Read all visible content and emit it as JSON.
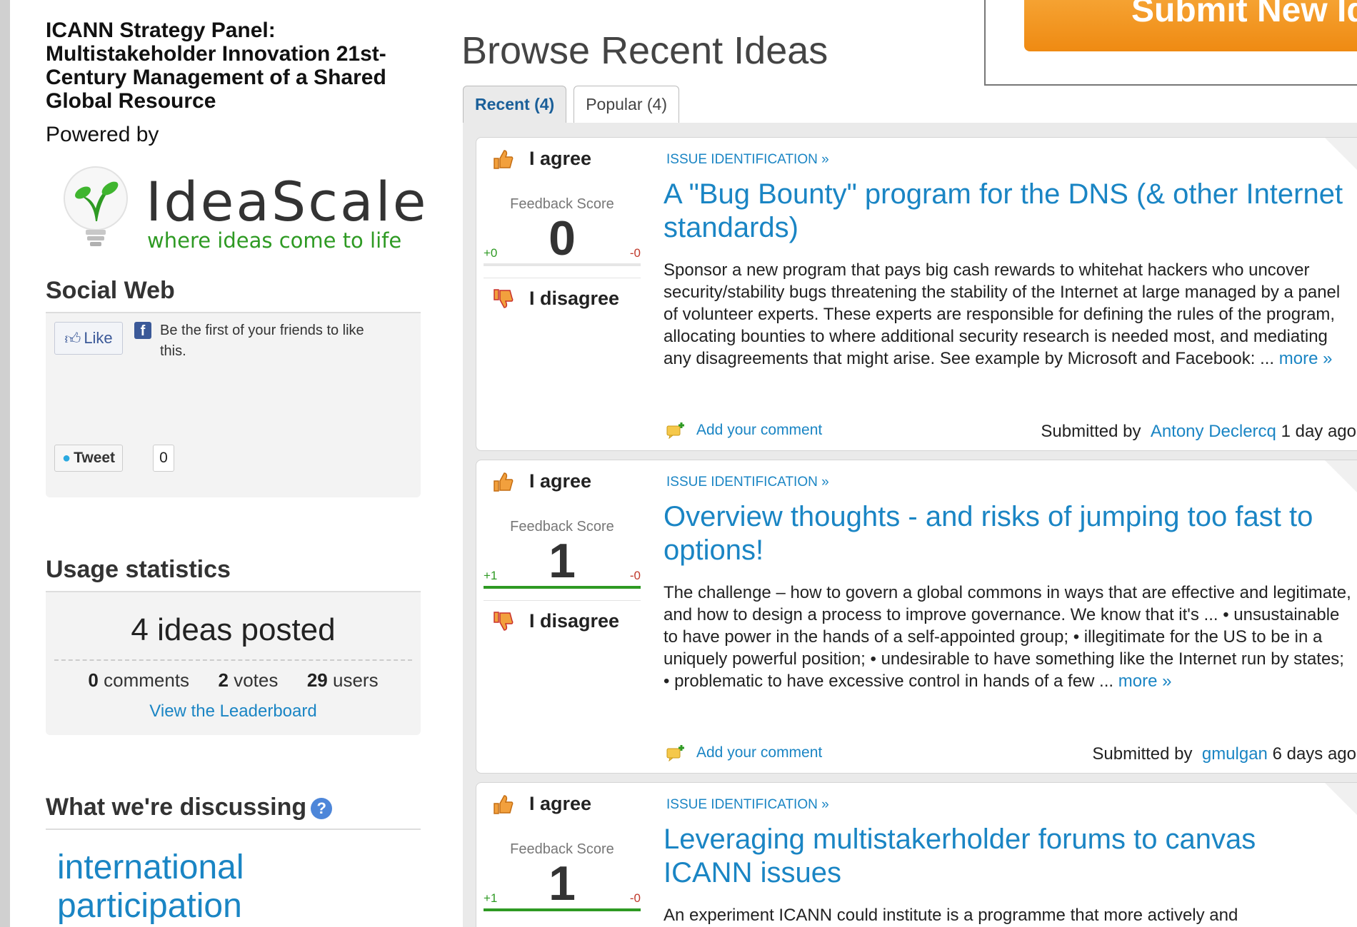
{
  "sidebar": {
    "site_title": "ICANN Strategy Panel: Multistakeholder Innovation 21st-Century Management of a Shared Global Resource",
    "powered_by": "Powered by",
    "logo_word": "IdeaScale",
    "logo_tagline": "where ideas come to life",
    "social_heading": "Social Web",
    "like_label": "Like",
    "like_text": "Be the first of your friends to like this.",
    "tweet_label": "Tweet",
    "tweet_count": "0",
    "usage_heading": "Usage statistics",
    "usage_main": "4 ideas posted",
    "comments_count": "0",
    "comments_label": "comments",
    "votes_count": "2",
    "votes_label": "votes",
    "users_count": "29",
    "users_label": "users",
    "leaderboard_link": "View the Leaderboard",
    "discuss_heading": "What we're discussing",
    "tag_1": "international",
    "tag_2": "participation"
  },
  "main": {
    "heading": "Browse Recent Ideas",
    "submit_label": "Submit New Idea",
    "tabs": [
      {
        "label": "Recent (4)",
        "active": true
      },
      {
        "label": "Popular (4)",
        "active": false
      }
    ],
    "vote": {
      "agree_label": "I agree",
      "disagree_label": "I disagree",
      "feedback_label": "Feedback Score",
      "add_comment": "Add your comment",
      "submitted_by": "Submitted by"
    },
    "ideas": [
      {
        "category": "ISSUE IDENTIFICATION »",
        "title": "A \"Bug Bounty\" program for the DNS (& other Internet standards)",
        "description": "Sponsor a new program that pays big cash rewards to whitehat hackers who uncover security/stability bugs threatening the stability of the Internet at large managed by a panel of volunteer experts. These experts are responsible for defining the rules of the program, allocating bounties to where additional security research is needed most, and mediating any disagreements that might arise. See example by Microsoft and Facebook: ...",
        "more": "more »",
        "score": "0",
        "plus": "+0",
        "minus": "-0",
        "author": "Antony Declercq",
        "age": "1 day ago"
      },
      {
        "category": "ISSUE IDENTIFICATION »",
        "title": "Overview thoughts - and risks of jumping too fast to options!",
        "description": "The challenge – how to govern a global commons in ways that are effective and legitimate, and how to design a process to improve governance. We know that it's ... • unsustainable to have power in the hands of a self-appointed group; • illegitimate for the US to be in a uniquely powerful position; • undesirable to have something like the Internet run by states; • problematic to have excessive control in hands of a few ...",
        "more": "more »",
        "score": "1",
        "plus": "+1",
        "minus": "-0",
        "author": "gmulgan",
        "age": "6 days ago"
      },
      {
        "category": "ISSUE IDENTIFICATION »",
        "title": "Leveraging multistakerholder forums to canvas ICANN issues",
        "description": "An experiment ICANN could institute is a programme that more actively and",
        "score": "1",
        "plus": "+1",
        "minus": "-0"
      }
    ]
  },
  "colors": {
    "link": "#1a85c4",
    "brand_green": "#2e9a23",
    "submit_orange": "#ef8a12"
  }
}
